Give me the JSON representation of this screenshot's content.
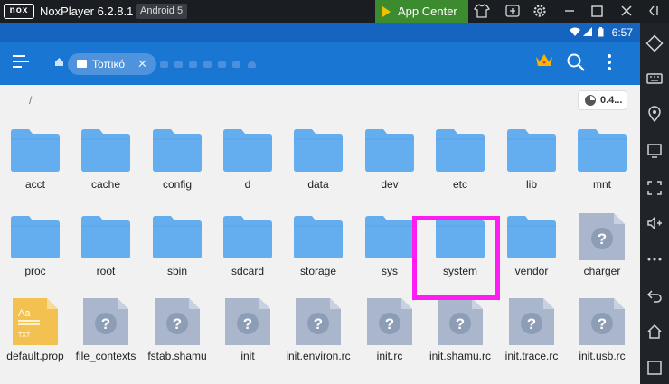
{
  "window": {
    "title": "NoxPlayer 6.2.8.1",
    "android_version": "Android 5",
    "app_center_label": "App Center",
    "logo_text": "nox"
  },
  "status_bar": {
    "time": "6:57"
  },
  "app_bar": {
    "tab_label": "Τοπικό",
    "tab_close": "✕"
  },
  "path": {
    "current": "/"
  },
  "storage": {
    "value": "0.4..."
  },
  "files": [
    {
      "name": "acct",
      "type": "folder"
    },
    {
      "name": "cache",
      "type": "folder"
    },
    {
      "name": "config",
      "type": "folder"
    },
    {
      "name": "d",
      "type": "folder"
    },
    {
      "name": "data",
      "type": "folder"
    },
    {
      "name": "dev",
      "type": "folder"
    },
    {
      "name": "etc",
      "type": "folder"
    },
    {
      "name": "lib",
      "type": "folder"
    },
    {
      "name": "mnt",
      "type": "folder"
    },
    {
      "name": "proc",
      "type": "folder"
    },
    {
      "name": "root",
      "type": "folder"
    },
    {
      "name": "sbin",
      "type": "folder"
    },
    {
      "name": "sdcard",
      "type": "folder"
    },
    {
      "name": "storage",
      "type": "folder"
    },
    {
      "name": "sys",
      "type": "folder"
    },
    {
      "name": "system",
      "type": "folder",
      "highlighted": true
    },
    {
      "name": "vendor",
      "type": "folder"
    },
    {
      "name": "charger",
      "type": "unknown"
    },
    {
      "name": "default.prop",
      "type": "text"
    },
    {
      "name": "file_contexts",
      "type": "unknown"
    },
    {
      "name": "fstab.shamu",
      "type": "unknown"
    },
    {
      "name": "init",
      "type": "unknown"
    },
    {
      "name": "init.environ.rc",
      "type": "unknown"
    },
    {
      "name": "init.rc",
      "type": "unknown"
    },
    {
      "name": "init.shamu.rc",
      "type": "unknown"
    },
    {
      "name": "init.trace.rc",
      "type": "unknown"
    },
    {
      "name": "init.usb.rc",
      "type": "unknown"
    }
  ],
  "icons": {
    "text_file_label_top": "Aa",
    "text_file_label_bottom": "TXT",
    "unknown_glyph": "?"
  },
  "colors": {
    "app_bar": "#1976d2",
    "status_bar": "#1565c0",
    "folder": "#64aef0",
    "highlight": "#ff1cf2",
    "app_center": "#3c8b2e"
  }
}
